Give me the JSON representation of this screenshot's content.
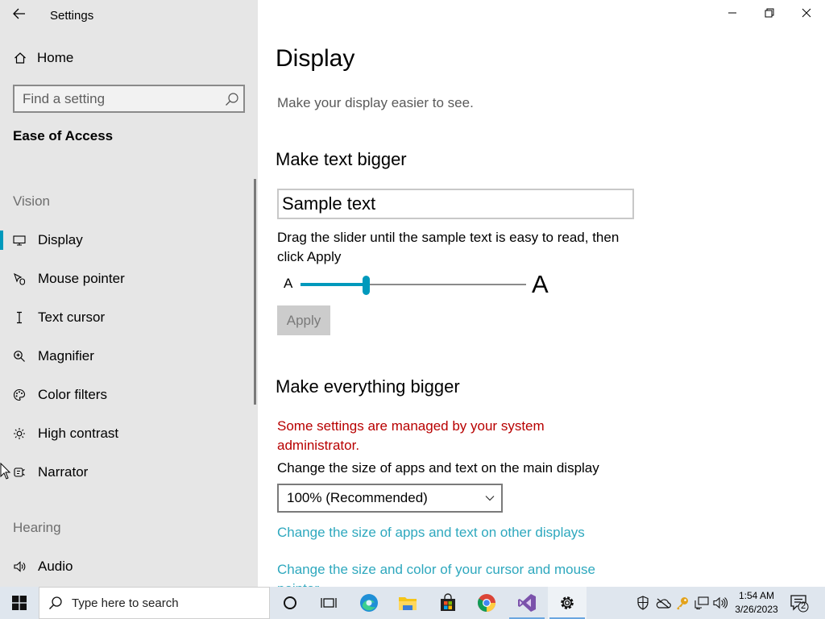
{
  "window": {
    "title": "Settings",
    "controls": {
      "minimize": "minimize-icon",
      "restore": "restore-icon",
      "close": "close-icon"
    }
  },
  "sidebar": {
    "home_label": "Home",
    "search_placeholder": "Find a setting",
    "section_title": "Ease of Access",
    "groups": [
      {
        "label": "Vision",
        "items": [
          {
            "label": "Display",
            "icon": "monitor-icon",
            "active": true
          },
          {
            "label": "Mouse pointer",
            "icon": "mouse-pointer-icon"
          },
          {
            "label": "Text cursor",
            "icon": "text-cursor-icon"
          },
          {
            "label": "Magnifier",
            "icon": "magnifier-icon"
          },
          {
            "label": "Color filters",
            "icon": "palette-icon"
          },
          {
            "label": "High contrast",
            "icon": "sun-icon"
          },
          {
            "label": "Narrator",
            "icon": "narrator-icon"
          }
        ]
      },
      {
        "label": "Hearing",
        "items": [
          {
            "label": "Audio",
            "icon": "speaker-icon"
          }
        ]
      }
    ]
  },
  "main": {
    "title": "Display",
    "description": "Make your display easier to see.",
    "text_bigger": {
      "heading": "Make text bigger",
      "sample_text": "Sample text",
      "helper": "Drag the slider until the sample text is easy to read, then click Apply",
      "slider_min_label": "A",
      "slider_max_label": "A",
      "slider_value_fraction": 0.29,
      "apply_label": "Apply"
    },
    "everything_bigger": {
      "heading": "Make everything bigger",
      "managed_notice": "Some settings are managed by your system administrator.",
      "size_label": "Change the size of apps and text on the main display",
      "size_value": "100% (Recommended)",
      "link_other_displays": "Change the size of apps and text on other displays",
      "link_cursor": "Change the size and color of your cursor and mouse pointer"
    }
  },
  "taskbar": {
    "search_placeholder": "Type here to search",
    "apps": [
      "cortana-icon",
      "task-view-icon",
      "edge-icon",
      "file-explorer-icon",
      "store-icon",
      "chrome-icon",
      "visual-studio-icon",
      "settings-icon"
    ],
    "tray": [
      "defender-icon",
      "onedrive-icon",
      "key-icon",
      "network-icon",
      "volume-icon"
    ],
    "time": "1:54 AM",
    "date": "3/26/2023",
    "notification_count": "2"
  },
  "colors": {
    "accent": "#0099bc",
    "link": "#2ea8be",
    "warning": "#b80000",
    "sidebar_bg": "#e6e6e6"
  }
}
